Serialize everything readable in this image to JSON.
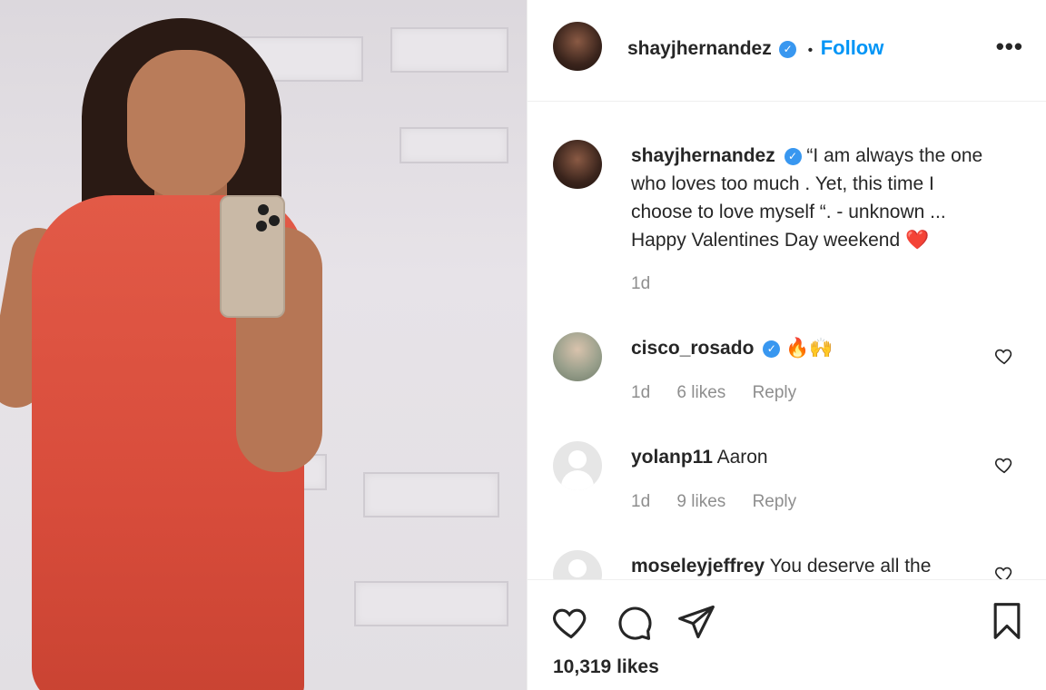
{
  "post": {
    "author": "shayjhernandez",
    "verified_icon": "verified-badge-icon",
    "follow_separator": "•",
    "follow_label": "Follow",
    "more_label": "•••",
    "caption_author": "shayjhernandez",
    "caption_lines": [
      "“I am always the one",
      "who loves too much . Yet, this time I",
      "choose to love myself “. - unknown ...",
      "Happy Valentines Day weekend ❤️"
    ],
    "caption_time": "1d",
    "likes_total": "10,319 likes"
  },
  "comments": [
    {
      "user": "cisco_rosado",
      "verified": true,
      "text": "🔥🙌",
      "time": "1d",
      "likes": "6 likes",
      "reply": "Reply"
    },
    {
      "user": "yolanp11",
      "verified": false,
      "text": "Aaron",
      "time": "1d",
      "likes": "9 likes",
      "reply": "Reply"
    },
    {
      "user": "moseleyjeffrey",
      "verified": false,
      "text": "You deserve all the",
      "time": "",
      "likes": "",
      "reply": ""
    }
  ],
  "colors": {
    "accent": "#0095f6",
    "verified": "#3897f0",
    "text": "#262626",
    "muted": "#8e8e8e",
    "dress": "#d84c3b"
  }
}
